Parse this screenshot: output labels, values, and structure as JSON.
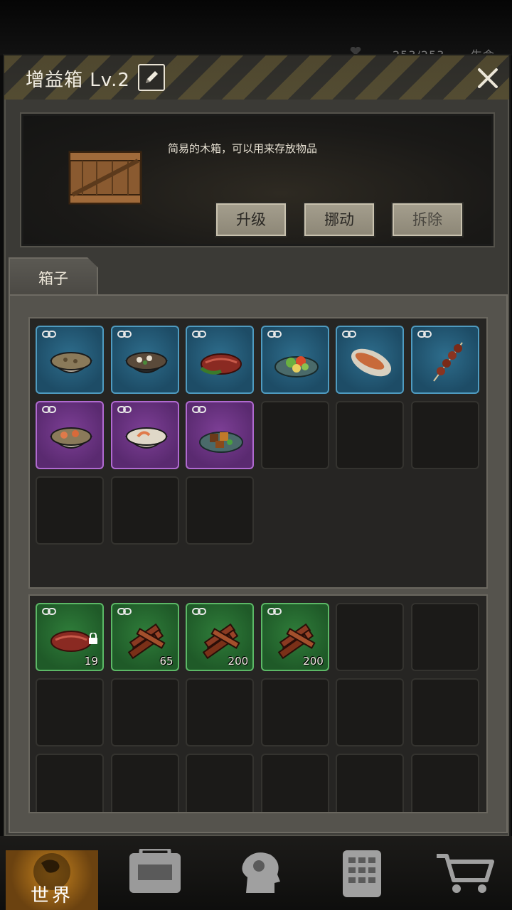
{
  "status_bar": {
    "stat_text": "253/253",
    "status_right": "生命"
  },
  "dialog": {
    "title": "增益箱 Lv.2",
    "edit_icon": "pencil-icon",
    "close_icon": "close-icon"
  },
  "info": {
    "description": "简易的木箱，可以用来存放物品",
    "upgrade_label": "升级",
    "move_label": "挪动",
    "demolish_label": "拆除"
  },
  "tabs": [
    {
      "label": "箱子"
    }
  ],
  "box_items": [
    {
      "rarity": "blue",
      "icon": "mushroom-soup-icon"
    },
    {
      "rarity": "blue",
      "icon": "stew-pot-icon"
    },
    {
      "rarity": "blue",
      "icon": "steak-icon"
    },
    {
      "rarity": "blue",
      "icon": "salad-icon"
    },
    {
      "rarity": "blue",
      "icon": "grilled-fish-icon"
    },
    {
      "rarity": "blue",
      "icon": "meat-skewer-icon"
    },
    {
      "rarity": "purple",
      "icon": "seafood-soup-icon"
    },
    {
      "rarity": "purple",
      "icon": "shrimp-soup-icon"
    },
    {
      "rarity": "purple",
      "icon": "fried-meat-icon"
    },
    {
      "rarity": "empty"
    },
    {
      "rarity": "empty"
    },
    {
      "rarity": "empty"
    },
    {
      "rarity": "empty"
    },
    {
      "rarity": "empty"
    },
    {
      "rarity": "empty"
    }
  ],
  "bag_items": [
    {
      "rarity": "green",
      "icon": "raw-meat-icon",
      "count": "19",
      "locked": true
    },
    {
      "rarity": "green",
      "icon": "jerky-icon",
      "count": "65"
    },
    {
      "rarity": "green",
      "icon": "jerky-icon",
      "count": "200"
    },
    {
      "rarity": "green",
      "icon": "jerky-icon",
      "count": "200"
    }
  ],
  "navbar": [
    {
      "label": "世界",
      "icon": "globe-icon"
    },
    {
      "label": "",
      "icon": "backpack-icon"
    },
    {
      "label": "",
      "icon": "head-gear-icon"
    },
    {
      "label": "",
      "icon": "phone-keypad-icon"
    },
    {
      "label": "",
      "icon": "shopping-cart-icon"
    }
  ],
  "colors": {
    "rarity_blue": "#4f9bc0",
    "rarity_purple": "#b06ad0",
    "rarity_green": "#5cb866",
    "world_tab": "#c8841e"
  }
}
